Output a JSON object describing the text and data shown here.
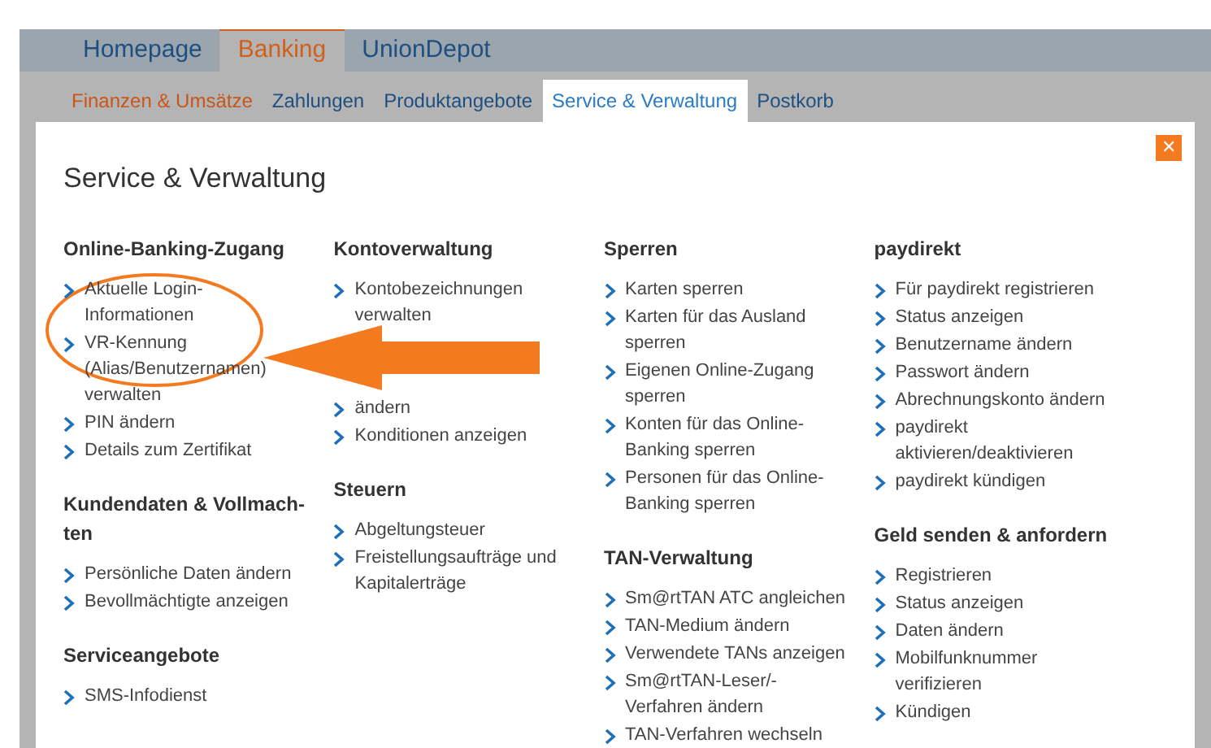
{
  "main_tabs": [
    {
      "label": "Homepage",
      "selected": false
    },
    {
      "label": "Banking",
      "selected": true
    },
    {
      "label": "UnionDepot",
      "selected": false
    }
  ],
  "sub_tabs": [
    {
      "label": "Finanzen & Umsätze",
      "selected": false,
      "highlighted": true
    },
    {
      "label": "Zahlungen",
      "selected": false,
      "highlighted": false
    },
    {
      "label": "Produktangebote",
      "selected": false,
      "highlighted": false
    },
    {
      "label": "Service & Verwaltung",
      "selected": true,
      "highlighted": false
    },
    {
      "label": "Postkorb",
      "selected": false,
      "highlighted": false
    }
  ],
  "panel": {
    "title": "Service & Verwaltung",
    "close": "✕",
    "columns": [
      [
        {
          "heading": "Online-Banking-Zugang",
          "items": [
            "Aktuelle Login-Informationen",
            "VR-Kennung (Alias/Benutzernamen) verwalten",
            "PIN ändern",
            "Details zum Zertifikat"
          ]
        },
        {
          "heading": "Kundendaten & Vollmach-ten",
          "items": [
            "Persönliche Daten ändern",
            "Bevollmächtigte anzeigen"
          ]
        },
        {
          "heading": "Serviceangebote",
          "items": [
            "SMS-Infodienst"
          ]
        }
      ],
      [
        {
          "heading": "Kontoverwaltung",
          "items": [
            "Kontobezeichnungen verwalten",
            "ändern",
            "Konditionen anzeigen"
          ]
        },
        {
          "heading": "Steuern",
          "items": [
            "Abgeltungsteuer",
            "Freistellungsaufträge und Kapitalerträge"
          ]
        }
      ],
      [
        {
          "heading": "Sperren",
          "items": [
            "Karten sperren",
            "Karten für das Ausland sperren",
            "Eigenen Online-Zugang sperren",
            "Konten für das Online-Banking sperren",
            "Personen für das Online-Banking sperren"
          ]
        },
        {
          "heading": "TAN-Verwaltung",
          "items": [
            "Sm@rtTAN ATC angleichen",
            "TAN-Medium ändern",
            "Verwendete TANs anzeigen",
            "Sm@rtTAN-Leser/-Verfahren ändern",
            "TAN-Verfahren wechseln"
          ]
        }
      ],
      [
        {
          "heading": "paydirekt",
          "items": [
            "Für paydirekt registrieren",
            "Status anzeigen",
            "Benutzername ändern",
            "Passwort ändern",
            "Abrechnungskonto ändern",
            "paydirekt aktivieren/deaktivieren",
            "paydirekt kündigen"
          ]
        },
        {
          "heading": "Geld senden & anfordern",
          "items": [
            "Registrieren",
            "Status anzeigen",
            "Daten ändern",
            "Mobilfunknummer verifizieren",
            "Kündigen"
          ]
        }
      ]
    ]
  }
}
